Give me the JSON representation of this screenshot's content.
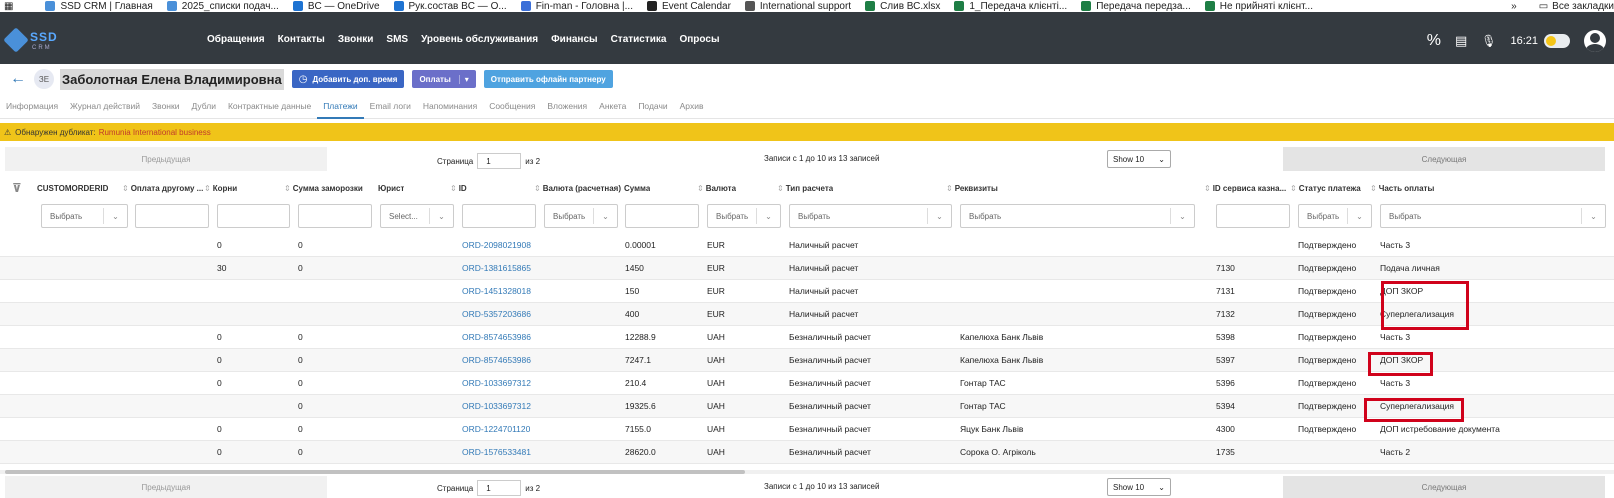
{
  "bookmarks": [
    {
      "label": "SSD CRM | Главная",
      "color": "#4a90d9"
    },
    {
      "label": "2025_списки подач...",
      "color": "#4a90d9"
    },
    {
      "label": "BC — OneDrive",
      "color": "#1e73d2"
    },
    {
      "label": "Рук.состав BC — O...",
      "color": "#1e73d2"
    },
    {
      "label": "Fin-man - Головна |...",
      "color": "#3b6fd8"
    },
    {
      "label": "Event Calendar",
      "color": "#222222"
    },
    {
      "label": "International support",
      "color": "#555555"
    },
    {
      "label": "Слив ВС.xlsx",
      "color": "#1e7e45"
    },
    {
      "label": "1_Передача клієнті...",
      "color": "#1e7e45"
    },
    {
      "label": "Передача передза...",
      "color": "#1e7e45"
    },
    {
      "label": "Не прийняті клієнт...",
      "color": "#1e7e45"
    }
  ],
  "bookmarks_more": "»",
  "bookmarks_all": "Все закладки",
  "logo": {
    "text": "SSD",
    "sub": "CRM"
  },
  "nav": [
    "Обращения",
    "Контакты",
    "Звонки",
    "SMS",
    "Уровень обслуживания",
    "Финансы",
    "Статистика",
    "Опросы"
  ],
  "clock": "16:21",
  "client": {
    "initials": "ЗЕ",
    "name": "Заболотная Елена Владимировна"
  },
  "buttons": {
    "add_time": "Добавить доп. время",
    "payments": "Оплаты",
    "send_offline": "Отправить офлайн партнеру"
  },
  "tabs": [
    "Информация",
    "Журнал действий",
    "Звонки",
    "Дубли",
    "Контрактные данные",
    "Платежи",
    "Email логи",
    "Напоминания",
    "Сообщения",
    "Вложения",
    "Анкета",
    "Подачи",
    "Архив"
  ],
  "active_tab": "Платежи",
  "warning": {
    "text": "Обнаружен дубликат:",
    "link": "Rumunia International business"
  },
  "pager": {
    "prev": "Предыдущая",
    "next": "Следующая",
    "page_label": "Страница",
    "page": "1",
    "of": "из 2",
    "info": "Записи с 1 до 10 из 13 записей",
    "show": "Show 10"
  },
  "columns": [
    "CUSTOMORDERID",
    "Оплата другому ...",
    "Корни",
    "Сумма заморозки",
    "Юрист",
    "ID",
    "Валюта (расчетная)",
    "Сумма",
    "Валюта",
    "Тип расчета",
    "Реквизиты",
    "ID сервиса казна...",
    "Статус платежа",
    "Часть оплаты"
  ],
  "filters": {
    "select": "Выбрать",
    "select_short": "Select..."
  },
  "rows": [
    {
      "korni": "0",
      "freeze": "0",
      "id": "ORD-2098021908",
      "sum": "0.00001",
      "cur": "EUR",
      "type": "Наличный расчет",
      "req": "",
      "svc": "",
      "status": "Подтверждено",
      "part": "Часть 3"
    },
    {
      "korni": "30",
      "freeze": "0",
      "id": "ORD-1381615865",
      "sum": "1450",
      "cur": "EUR",
      "type": "Наличный расчет",
      "req": "",
      "svc": "7130",
      "status": "Подтверждено",
      "part": "Подача личная"
    },
    {
      "korni": "",
      "freeze": "",
      "id": "ORD-1451328018",
      "sum": "150",
      "cur": "EUR",
      "type": "Наличный расчет",
      "req": "",
      "svc": "7131",
      "status": "Подтверждено",
      "part": "ДОП ЗКОР"
    },
    {
      "korni": "",
      "freeze": "",
      "id": "ORD-5357203686",
      "sum": "400",
      "cur": "EUR",
      "type": "Наличный расчет",
      "req": "",
      "svc": "7132",
      "status": "Подтверждено",
      "part": "Суперлегализация"
    },
    {
      "korni": "0",
      "freeze": "0",
      "id": "ORD-8574653986",
      "sum": "12288.9",
      "cur": "UAH",
      "type": "Безналичный расчет",
      "req": "Капелюха Банк Львів",
      "svc": "5398",
      "status": "Подтверждено",
      "part": "Часть 3"
    },
    {
      "korni": "0",
      "freeze": "0",
      "id": "ORD-8574653986",
      "sum": "7247.1",
      "cur": "UAH",
      "type": "Безналичный расчет",
      "req": "Капелюха Банк Львів",
      "svc": "5397",
      "status": "Подтверждено",
      "part": "ДОП ЗКОР"
    },
    {
      "korni": "0",
      "freeze": "0",
      "id": "ORD-1033697312",
      "sum": "210.4",
      "cur": "UAH",
      "type": "Безналичный расчет",
      "req": "Гонтар ТАС",
      "svc": "5396",
      "status": "Подтверждено",
      "part": "Часть 3"
    },
    {
      "korni": "",
      "freeze": "0",
      "id": "ORD-1033697312",
      "sum": "19325.6",
      "cur": "UAH",
      "type": "Безналичный расчет",
      "req": "Гонтар ТАС",
      "svc": "5394",
      "status": "Подтверждено",
      "part": "Суперлегализация"
    },
    {
      "korni": "0",
      "freeze": "0",
      "id": "ORD-1224701120",
      "sum": "7155.0",
      "cur": "UAH",
      "type": "Безналичный расчет",
      "req": "Яцук Банк Львів",
      "svc": "4300",
      "status": "Подтверждено",
      "part": "ДОП истребование документа"
    },
    {
      "korni": "0",
      "freeze": "0",
      "id": "ORD-1576533481",
      "sum": "28620.0",
      "cur": "UAH",
      "type": "Безналичный расчет",
      "req": "Сорока О. Агріколь",
      "svc": "1735",
      "status": "",
      "part": "Часть 2"
    }
  ],
  "colors": {
    "nav_bg": "#343a40",
    "warning_bg": "#f0c419",
    "highlight": "#d0021b",
    "link": "#337ab7"
  }
}
